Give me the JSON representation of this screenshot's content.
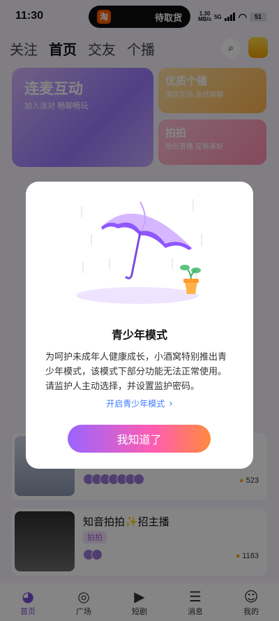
{
  "status_bar": {
    "time": "11:30",
    "island_app": "淘",
    "island_text": "待取货",
    "net_speed": "1.30",
    "net_unit": "MB/s",
    "net_type": "5G",
    "battery": "51"
  },
  "header": {
    "tabs": [
      "关注",
      "首页",
      "交友",
      "个播"
    ],
    "active_tab": "首页",
    "search_icon": "search-icon"
  },
  "banners": {
    "main": {
      "title": "连麦互动",
      "subtitle": "加入派对 畅聊畅玩"
    },
    "card1": {
      "title": "优质个播",
      "subtitle": "情感互动 连线聊聊"
    },
    "card2": {
      "title": "拍拍",
      "subtitle": "拍出直播 定格美好"
    }
  },
  "list": [
    {
      "count": "523"
    },
    {
      "title": "知音拍拍✨招主播",
      "tag": "拍拍",
      "count": "1183"
    }
  ],
  "nav": [
    {
      "label": "首页",
      "icon": "home-bear-icon"
    },
    {
      "label": "广场",
      "icon": "plaza-icon"
    },
    {
      "label": "短剧",
      "icon": "play-icon"
    },
    {
      "label": "消息",
      "icon": "message-icon"
    },
    {
      "label": "我的",
      "icon": "profile-icon"
    }
  ],
  "dialog": {
    "title": "青少年模式",
    "body": "为呵护未成年人健康成长，小酒窝特别推出青少年模式，该模式下部分功能无法正常使用。请监护人主动选择，并设置监护密码。",
    "link": "开启青少年模式",
    "button": "我知道了"
  }
}
